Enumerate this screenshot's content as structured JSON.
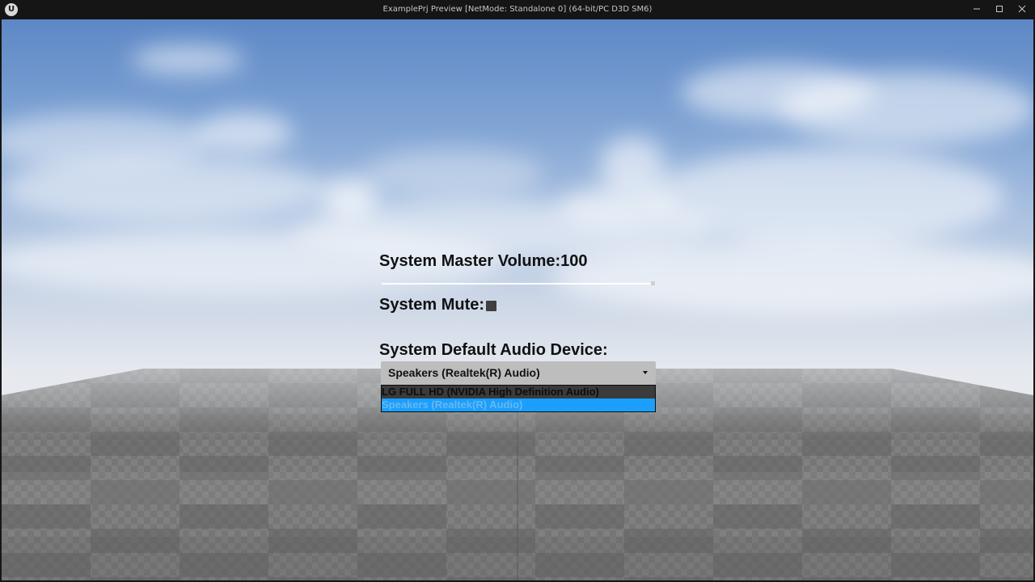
{
  "window": {
    "title": "ExamplePrj Preview [NetMode: Standalone 0]  (64-bit/PC D3D SM6)",
    "logo_text": "U"
  },
  "settings": {
    "master_volume_label": "System Master Volume:",
    "master_volume_value": "100",
    "master_volume_fraction": 1.0,
    "mute_label": "System Mute:",
    "mute_checked": false,
    "audio_device_label": "System Default Audio Device:",
    "selected_device": "Speakers (Realtek(R) Audio)",
    "device_options": [
      {
        "label": "LG FULL HD (NVIDIA High Definition Audio)",
        "selected": false
      },
      {
        "label": "Speakers (Realtek(R) Audio)",
        "selected": true
      }
    ]
  },
  "colors": {
    "selection_highlight": "#1a9fff",
    "combo_background": "#bdbdbd",
    "checkbox": "#3f3f3f"
  }
}
